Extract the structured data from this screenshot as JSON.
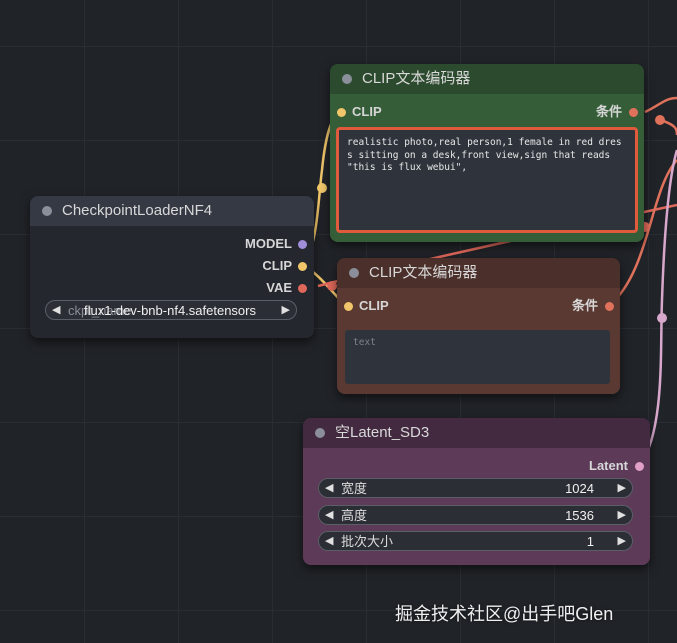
{
  "colors": {
    "canvas_bg": "#202328",
    "clip_slot": "#f1c66a",
    "vae_slot": "#e0685a",
    "model_slot": "#a08ed8",
    "conditioning_slot": "#e0725c",
    "latent_slot": "#e0a0c8",
    "highlight_border": "#e05a3c"
  },
  "nodes": {
    "clip_encoder_top": {
      "title": "CLIP文本编码器",
      "input_label": "CLIP",
      "output_label": "条件",
      "text_value": "realistic photo,real person,1 female in red dress sitting on a desk,front view,sign that reads \"this is flux webui\","
    },
    "checkpoint_loader": {
      "title": "CheckpointLoaderNF4",
      "outputs": [
        "MODEL",
        "CLIP",
        "VAE"
      ],
      "widget_name": "ckpt_name",
      "widget_value": "flux1-dev-bnb-nf4.safetensors",
      "left_arrow": "◀",
      "right_arrow": "▶"
    },
    "clip_encoder_bottom": {
      "title": "CLIP文本编码器",
      "input_label": "CLIP",
      "output_label": "条件",
      "text_placeholder": "text"
    },
    "empty_latent": {
      "title": "空Latent_SD3",
      "output_label": "Latent",
      "widgets": [
        {
          "label": "宽度",
          "value": "1024"
        },
        {
          "label": "高度",
          "value": "1536"
        },
        {
          "label": "批次大小",
          "value": "1"
        }
      ],
      "left_arrow": "◀",
      "right_arrow": "▶"
    }
  },
  "watermark": {
    "text": "掘金技术社区@出手吧Glen"
  }
}
